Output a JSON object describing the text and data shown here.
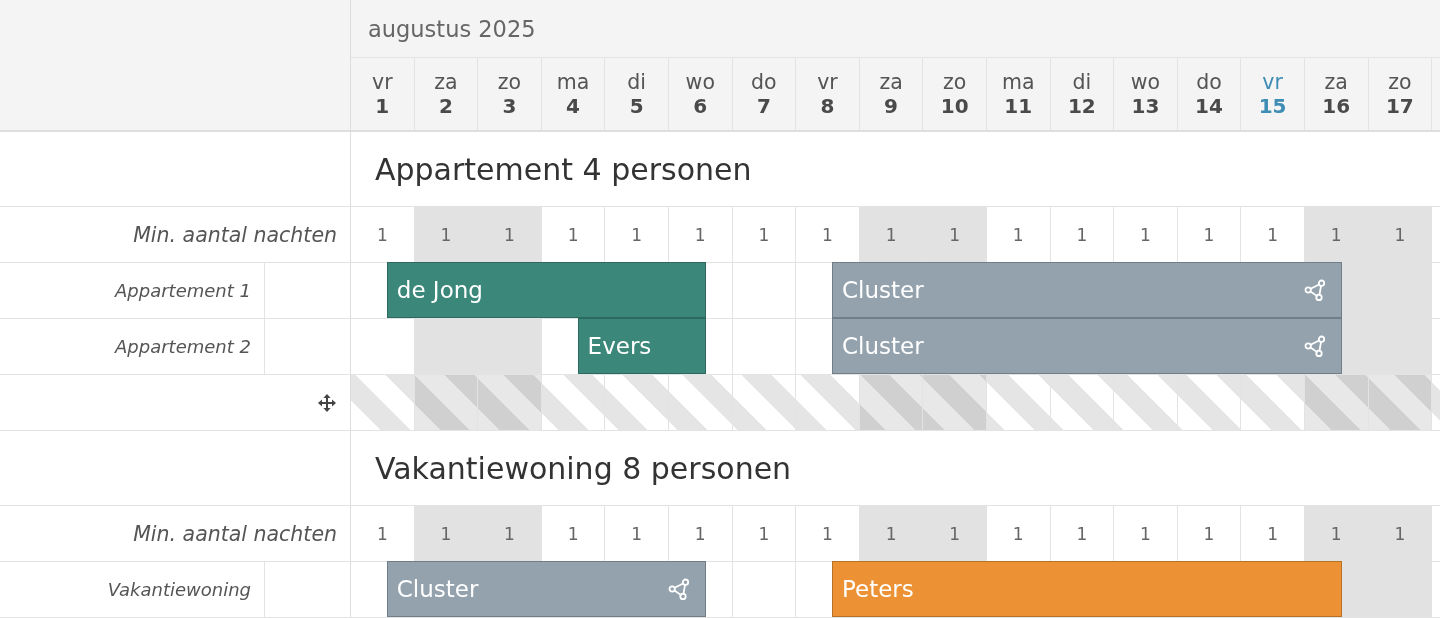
{
  "calendar": {
    "month": "augustus 2025",
    "days": [
      {
        "weekday": "vr",
        "date": "1",
        "weekend": false,
        "today": false
      },
      {
        "weekday": "za",
        "date": "2",
        "weekend": true,
        "today": false
      },
      {
        "weekday": "zo",
        "date": "3",
        "weekend": true,
        "today": false
      },
      {
        "weekday": "ma",
        "date": "4",
        "weekend": false,
        "today": false
      },
      {
        "weekday": "di",
        "date": "5",
        "weekend": false,
        "today": false
      },
      {
        "weekday": "wo",
        "date": "6",
        "weekend": false,
        "today": false
      },
      {
        "weekday": "do",
        "date": "7",
        "weekend": false,
        "today": false
      },
      {
        "weekday": "vr",
        "date": "8",
        "weekend": false,
        "today": false
      },
      {
        "weekday": "za",
        "date": "9",
        "weekend": true,
        "today": false
      },
      {
        "weekday": "zo",
        "date": "10",
        "weekend": true,
        "today": false
      },
      {
        "weekday": "ma",
        "date": "11",
        "weekend": false,
        "today": false
      },
      {
        "weekday": "di",
        "date": "12",
        "weekend": false,
        "today": false
      },
      {
        "weekday": "wo",
        "date": "13",
        "weekend": false,
        "today": false
      },
      {
        "weekday": "do",
        "date": "14",
        "weekend": false,
        "today": false
      },
      {
        "weekday": "vr",
        "date": "15",
        "weekend": false,
        "today": true
      },
      {
        "weekday": "za",
        "date": "16",
        "weekend": true,
        "today": false
      },
      {
        "weekday": "zo",
        "date": "17",
        "weekend": true,
        "today": false
      }
    ]
  },
  "groups": [
    {
      "title": "Appartement 4 personen",
      "rows": [
        {
          "kind": "min_nights",
          "label": "Min. aantal nachten",
          "values": [
            "1",
            "1",
            "1",
            "1",
            "1",
            "1",
            "1",
            "1",
            "1",
            "1",
            "1",
            "1",
            "1",
            "1",
            "1",
            "1",
            "1"
          ]
        },
        {
          "kind": "unit",
          "name": "Appartement 1",
          "nights": [
            {
              "kind": "guest",
              "label": "de Jong",
              "color": "#3b877a"
            },
            {
              "kind": "stay"
            },
            {
              "kind": "stay"
            },
            {
              "kind": "stay"
            },
            {
              "kind": "stay"
            },
            {
              "kind": "free"
            },
            {
              "kind": "free"
            },
            {
              "kind": "cluster",
              "label": "Cluster",
              "color": "#93a2ad"
            },
            {
              "kind": "stay"
            },
            {
              "kind": "stay"
            },
            {
              "kind": "stay"
            },
            {
              "kind": "stay"
            },
            {
              "kind": "stay"
            },
            {
              "kind": "stay"
            },
            {
              "kind": "stay"
            },
            {
              "kind": "free"
            },
            {
              "kind": "free"
            }
          ]
        },
        {
          "kind": "unit",
          "name": "Appartement 2",
          "nights": [
            {
              "kind": "free"
            },
            {
              "kind": "free"
            },
            {
              "kind": "free"
            },
            {
              "kind": "guest",
              "label": "Evers",
              "color": "#3b877a"
            },
            {
              "kind": "stay"
            },
            {
              "kind": "free"
            },
            {
              "kind": "free"
            },
            {
              "kind": "cluster",
              "label": "Cluster",
              "color": "#93a2ad"
            },
            {
              "kind": "stay"
            },
            {
              "kind": "stay"
            },
            {
              "kind": "stay"
            },
            {
              "kind": "stay"
            },
            {
              "kind": "stay"
            },
            {
              "kind": "stay"
            },
            {
              "kind": "stay"
            },
            {
              "kind": "free"
            },
            {
              "kind": "free"
            }
          ]
        },
        {
          "kind": "unassigned"
        }
      ]
    },
    {
      "title": "Vakantiewoning 8 personen",
      "rows": [
        {
          "kind": "min_nights",
          "label": "Min. aantal nachten",
          "values": [
            "1",
            "1",
            "1",
            "1",
            "1",
            "1",
            "1",
            "1",
            "1",
            "1",
            "1",
            "1",
            "1",
            "1",
            "1",
            "1",
            "1"
          ]
        },
        {
          "kind": "unit",
          "name": "Vakantiewoning",
          "nights": [
            {
              "kind": "cluster",
              "label": "Cluster",
              "color": "#93a2ad"
            },
            {
              "kind": "stay"
            },
            {
              "kind": "stay"
            },
            {
              "kind": "stay"
            },
            {
              "kind": "stay"
            },
            {
              "kind": "free"
            },
            {
              "kind": "free"
            },
            {
              "kind": "guest",
              "label": "Peters",
              "color": "#ec9234"
            },
            {
              "kind": "stay"
            },
            {
              "kind": "stay"
            },
            {
              "kind": "stay"
            },
            {
              "kind": "stay"
            },
            {
              "kind": "stay"
            },
            {
              "kind": "stay"
            },
            {
              "kind": "stay"
            },
            {
              "kind": "free"
            },
            {
              "kind": "free"
            }
          ]
        }
      ]
    }
  ]
}
